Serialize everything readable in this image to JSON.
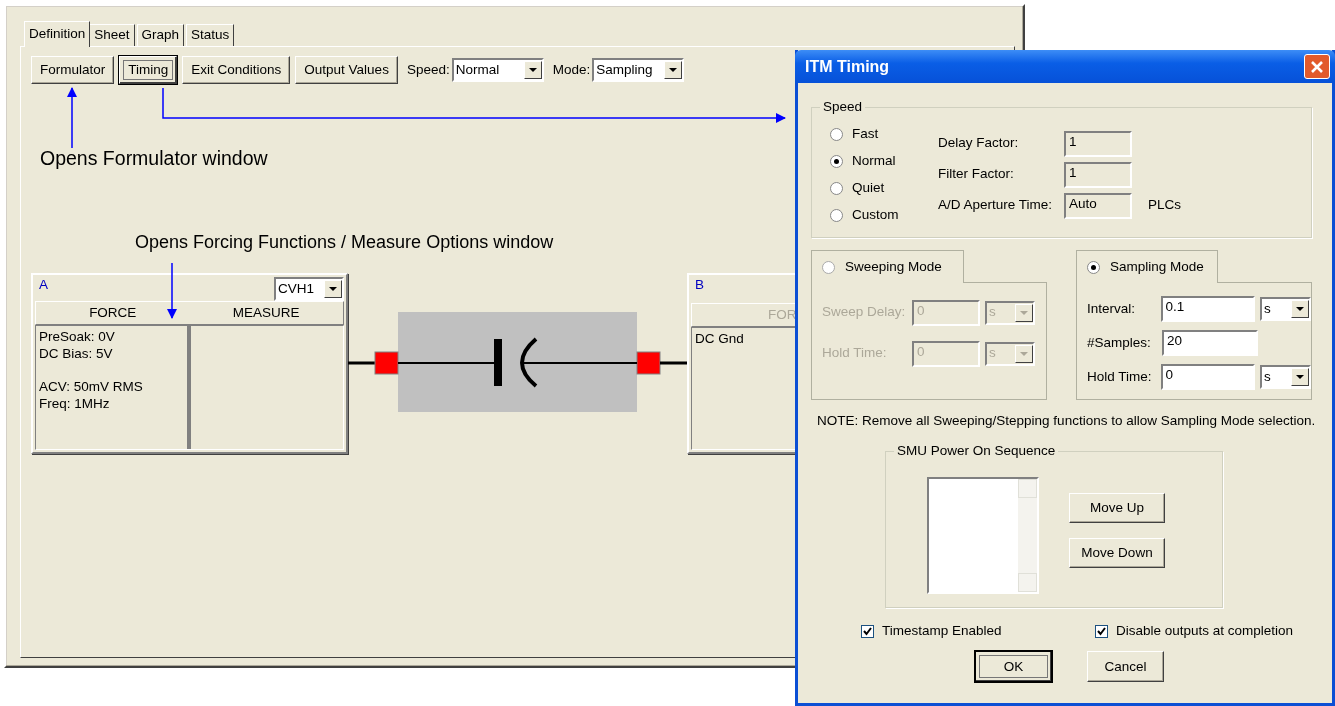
{
  "main_window": {
    "tabs": [
      {
        "label": "Definition",
        "selected": true
      },
      {
        "label": "Sheet",
        "selected": false
      },
      {
        "label": "Graph",
        "selected": false
      },
      {
        "label": "Status",
        "selected": false
      }
    ],
    "toolbar": {
      "buttons": [
        {
          "label": "Formulator",
          "focused": false
        },
        {
          "label": "Timing",
          "focused": true
        },
        {
          "label": "Exit Conditions",
          "focused": false
        },
        {
          "label": "Output Values",
          "focused": false
        }
      ],
      "speed": {
        "label": "Speed:",
        "value": "Normal"
      },
      "mode": {
        "label": "Mode:",
        "value": "Sampling"
      }
    },
    "instrument_a": {
      "name": "A",
      "terminal": "CVH1",
      "headers": [
        "FORCE",
        "MEASURE"
      ],
      "force_groups": [
        {
          "lines": [
            "PreSoak: 0V",
            "DC Bias: 5V"
          ]
        },
        {
          "lines": [
            "ACV: 50mV RMS",
            "Freq: 1MHz"
          ]
        }
      ]
    },
    "instrument_b": {
      "name": "B",
      "header": "FOR",
      "force_text": "DC Gnd"
    }
  },
  "annotations": [
    {
      "text": "Opens Formulator window"
    },
    {
      "text": "Opens Forcing Functions / Measure Options window"
    }
  ],
  "dialog": {
    "title": "ITM Timing",
    "speed": {
      "legend": "Speed",
      "options": [
        {
          "label": "Fast",
          "selected": false
        },
        {
          "label": "Normal",
          "selected": true
        },
        {
          "label": "Quiet",
          "selected": false
        },
        {
          "label": "Custom",
          "selected": false
        }
      ],
      "fields": [
        {
          "label": "Delay Factor:",
          "value": "1"
        },
        {
          "label": "Filter Factor:",
          "value": "1"
        },
        {
          "label": "A/D Aperture Time:",
          "value": "Auto",
          "unit": "PLCs"
        }
      ]
    },
    "modes": [
      {
        "label": "Sweeping Mode",
        "selected": false,
        "disabled": true,
        "fields": [
          {
            "label": "Sweep Delay:",
            "value": "0",
            "unit": "s"
          },
          {
            "label": "Hold Time:",
            "value": "0",
            "unit": "s"
          }
        ]
      },
      {
        "label": "Sampling Mode",
        "selected": true,
        "disabled": false,
        "fields": [
          {
            "label": "Interval:",
            "value": "0.1",
            "unit": "s"
          },
          {
            "label": "#Samples:",
            "value": "20"
          },
          {
            "label": "Hold Time:",
            "value": "0",
            "unit": "s"
          }
        ]
      }
    ],
    "note": "NOTE: Remove all Sweeping/Stepping functions to allow Sampling Mode selection.",
    "power_on": {
      "legend": "SMU Power On Sequence",
      "buttons": [
        "Move Up",
        "Move Down"
      ]
    },
    "checkboxes": [
      {
        "label": "Timestamp Enabled",
        "checked": true
      },
      {
        "label": "Disable outputs at completion",
        "checked": true
      }
    ],
    "buttons": [
      {
        "label": "OK",
        "default": true
      },
      {
        "label": "Cancel",
        "default": false
      }
    ]
  }
}
